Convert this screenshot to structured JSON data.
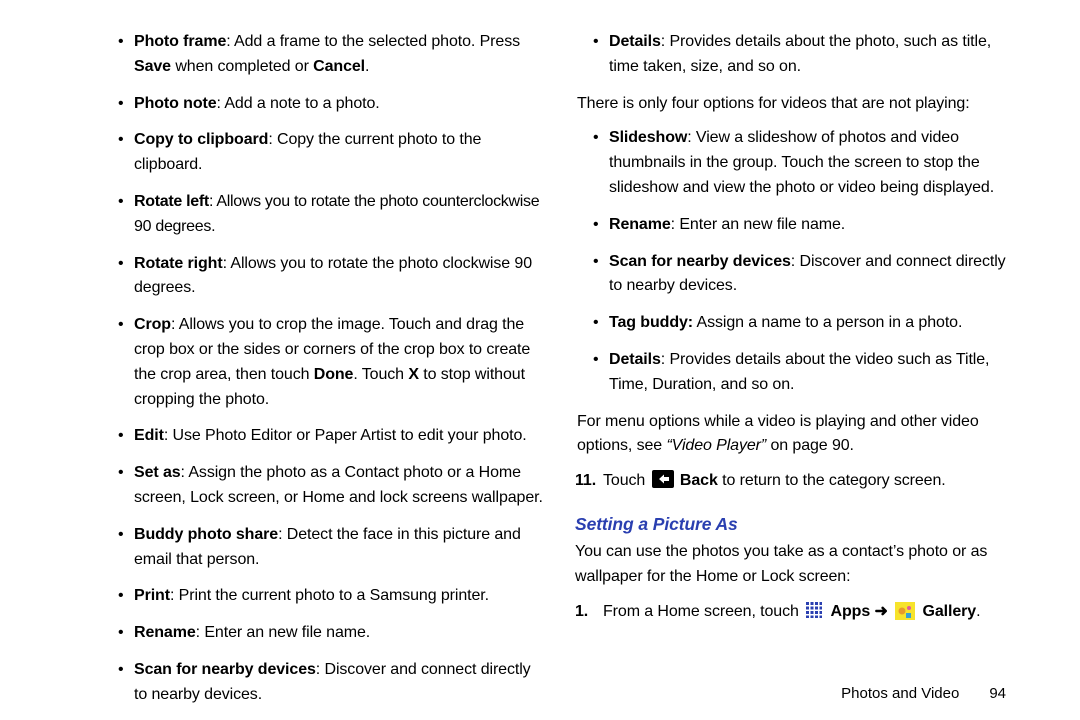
{
  "left": {
    "items": [
      {
        "term": "Photo frame",
        "body1": ": Add a frame to the selected photo. Press ",
        "b1": "Save",
        "body2": " when completed or ",
        "b2": "Cancel",
        "body3": "."
      },
      {
        "term": "Photo note",
        "body1": ": Add a note to a photo."
      },
      {
        "term": "Copy to clipboard",
        "body1": ": Copy the current photo to the clipboard."
      },
      {
        "term": "Rotate left",
        "body1": ": Allows you to rotate the photo counterclockwise 90 degrees."
      },
      {
        "term": "Rotate right",
        "body1": ": Allows you to rotate the photo clockwise 90 degrees."
      },
      {
        "term": "Crop",
        "body1": ": Allows you to crop the image. Touch and drag the crop box or the sides or corners of the crop box to create the crop area, then touch ",
        "b1": "Done",
        "body2": ". Touch ",
        "b2": "X",
        "body3": " to stop without cropping the photo."
      },
      {
        "term": "Edit",
        "body1": ": Use Photo Editor or Paper Artist to edit your photo."
      },
      {
        "term": "Set as",
        "body1": ": Assign the photo as a Contact photo or a Home screen, Lock screen, or Home and lock screens wallpaper."
      },
      {
        "term": "Buddy photo share",
        "body1": ": Detect the face in this picture and email that person."
      },
      {
        "term": "Print",
        "body1": ": Print the current photo to a Samsung printer."
      },
      {
        "term": "Rename",
        "body1": ": Enter an new file name."
      },
      {
        "term": "Scan for nearby devices",
        "body1": ": Discover and connect directly to nearby devices."
      }
    ]
  },
  "right": {
    "top_items": [
      {
        "term": "Details",
        "body1": ": Provides details about the photo, such as title, time taken, size, and so on."
      }
    ],
    "video_note": "There is only four options for videos that are not playing:",
    "video_items": [
      {
        "term": "Slideshow",
        "body1": ": View a slideshow of photos and video thumbnails in the group. Touch the screen to stop the slideshow and view the photo or video being displayed."
      },
      {
        "term": "Rename",
        "body1": ": Enter an new file name."
      },
      {
        "term": "Scan for nearby devices",
        "body1": ": Discover and connect directly to nearby devices."
      },
      {
        "term": "Tag buddy:",
        "body1": " Assign a name to a person in a photo."
      },
      {
        "term": "Details",
        "body1": ": Provides details about the video such as Title, Time, Duration, and so on."
      }
    ],
    "video_ref_1": "For menu options while a video is playing and other video options, see ",
    "video_ref_italic": "“Video Player”",
    "video_ref_2": " on page 90.",
    "step11_num": "11.",
    "step11_a": "Touch ",
    "step11_back": " Back",
    "step11_b": " to return to the category screen.",
    "section_title": "Setting a Picture As",
    "section_intro": "You can use the photos you take as a contact’s photo or as wallpaper for the Home or Lock screen:",
    "step1_num": "1.",
    "step1_a": "From a Home screen, touch ",
    "step1_apps": " Apps ",
    "step1_arrow": "➜",
    "step1_gallery": " Gallery",
    "step1_end": "."
  },
  "footer": {
    "section": "Photos and Video",
    "page": "94"
  }
}
